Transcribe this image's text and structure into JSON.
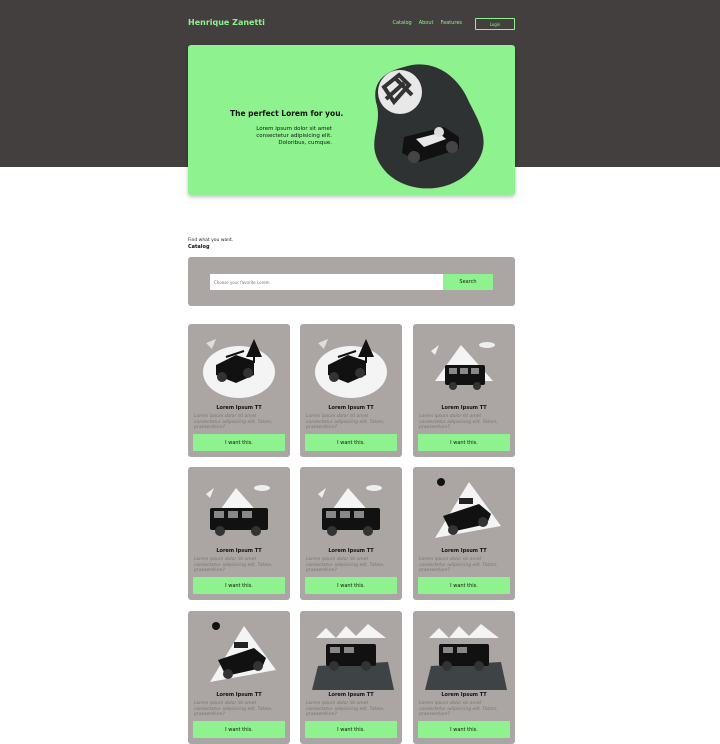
{
  "nav": {
    "brand": "Henrique Zanetti",
    "links": [
      "Catalog",
      "About",
      "Features"
    ],
    "login": "Login"
  },
  "hero": {
    "title": "The perfect Lorem for you.",
    "description": "Lorem ipsum dolor sit amet consectetur adipisicing elit. Doloribus, cumque."
  },
  "catalog": {
    "subtitle": "Find what you want.",
    "title": "Catalog",
    "search_placeholder": "Choose your favorite Lorem",
    "search_button": "Search"
  },
  "colors": {
    "accent": "#8ef28e",
    "dark": "#433f3f",
    "card": "#aba5a4"
  },
  "cards": [
    {
      "title": "Lorem Ipsum TT",
      "description": "Lorem ipsum dolor sit amet consectetur adipisicing elit. Totam, praesentium?",
      "button": "I want this.",
      "art": "jeep-forest"
    },
    {
      "title": "Lorem Ipsum TT",
      "description": "Lorem ipsum dolor sit amet consectetur adipisicing elit. Totam, praesentium?",
      "button": "I want this.",
      "art": "jeep-forest"
    },
    {
      "title": "Lorem Ipsum TT",
      "description": "Lorem ipsum dolor sit amet consectetur adipisicing elit. Totam, praesentium?",
      "button": "I want this.",
      "art": "suv-mountain"
    },
    {
      "title": "Lorem Ipsum TT",
      "description": "Lorem ipsum dolor sit amet consectetur adipisicing elit. Totam, praesentium?",
      "button": "I want this.",
      "art": "suv-mountain"
    },
    {
      "title": "Lorem Ipsum TT",
      "description": "Lorem ipsum dolor sit amet consectetur adipisicing elit. Totam, praesentium?",
      "button": "I want this.",
      "art": "suv-mountain"
    },
    {
      "title": "Lorem Ipsum TT",
      "description": "Lorem ipsum dolor sit amet consectetur adipisicing elit. Totam, praesentium?",
      "button": "I want this.",
      "art": "jeep-hill"
    },
    {
      "title": "Lorem Ipsum TT",
      "description": "Lorem ipsum dolor sit amet consectetur adipisicing elit. Totam, praesentium?",
      "button": "I want this.",
      "art": "jeep-hill"
    },
    {
      "title": "Lorem Ipsum TT",
      "description": "Lorem ipsum dolor sit amet consectetur adipisicing elit. Totam, praesentium?",
      "button": "I want this.",
      "art": "jeep-rock"
    },
    {
      "title": "Lorem Ipsum TT",
      "description": "Lorem ipsum dolor sit amet consectetur adipisicing elit. Totam, praesentium?",
      "button": "I want this.",
      "art": "jeep-rock"
    }
  ]
}
